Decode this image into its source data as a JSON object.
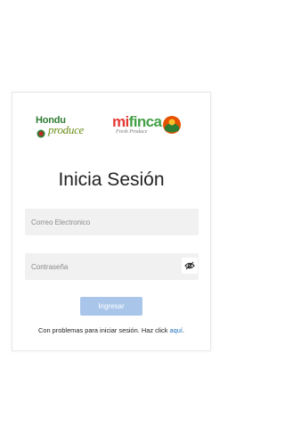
{
  "logos": {
    "hondu_top": "Hondu",
    "hondu_bottom": "produce",
    "mifinca_mi": "mi",
    "mifinca_finca": "finca",
    "mifinca_tagline": "Fresh Produce"
  },
  "login": {
    "title": "Inicia Sesión",
    "email_placeholder": "Correo Electronico",
    "password_placeholder": "Contraseña",
    "submit_label": "Ingresar",
    "help_text": "Con problemas para iniciar sesión. Haz click ",
    "help_link": "aquí",
    "help_end": "."
  },
  "colors": {
    "button_disabled": "#a9c6ea",
    "link": "#1e6fbf",
    "field_bg": "#f1f1f1"
  },
  "icons": {
    "password_toggle": "eye-slash-icon"
  }
}
